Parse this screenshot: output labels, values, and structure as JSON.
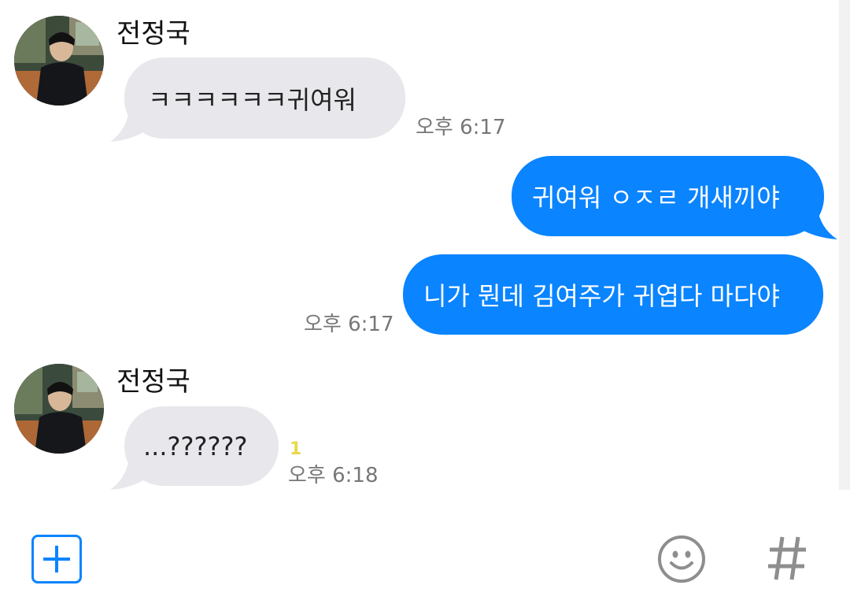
{
  "messages": [
    {
      "direction": "incoming",
      "sender": "전정국",
      "text": "ㅋㅋㅋㅋㅋㅋ귀여워",
      "time": "오후 6:17"
    },
    {
      "direction": "outgoing",
      "text": "귀여워 ㅇㅈㄹ 개새끼야"
    },
    {
      "direction": "outgoing",
      "text": "니가 뭔데 김여주가 귀엽다 마다야",
      "time": "오후 6:17"
    },
    {
      "direction": "incoming",
      "sender": "전정국",
      "text": "...??????",
      "unread_count": "1",
      "time": "오후 6:18"
    }
  ],
  "input_bar": {
    "add_icon": "plus-icon",
    "emoji_icon": "smiley-icon",
    "hashtag_icon": "hash-icon"
  },
  "colors": {
    "outgoing_bubble": "#0a84ff",
    "incoming_bubble": "#e8e8ec",
    "unread_badge": "#e8d84a",
    "accent": "#0a84ff"
  }
}
